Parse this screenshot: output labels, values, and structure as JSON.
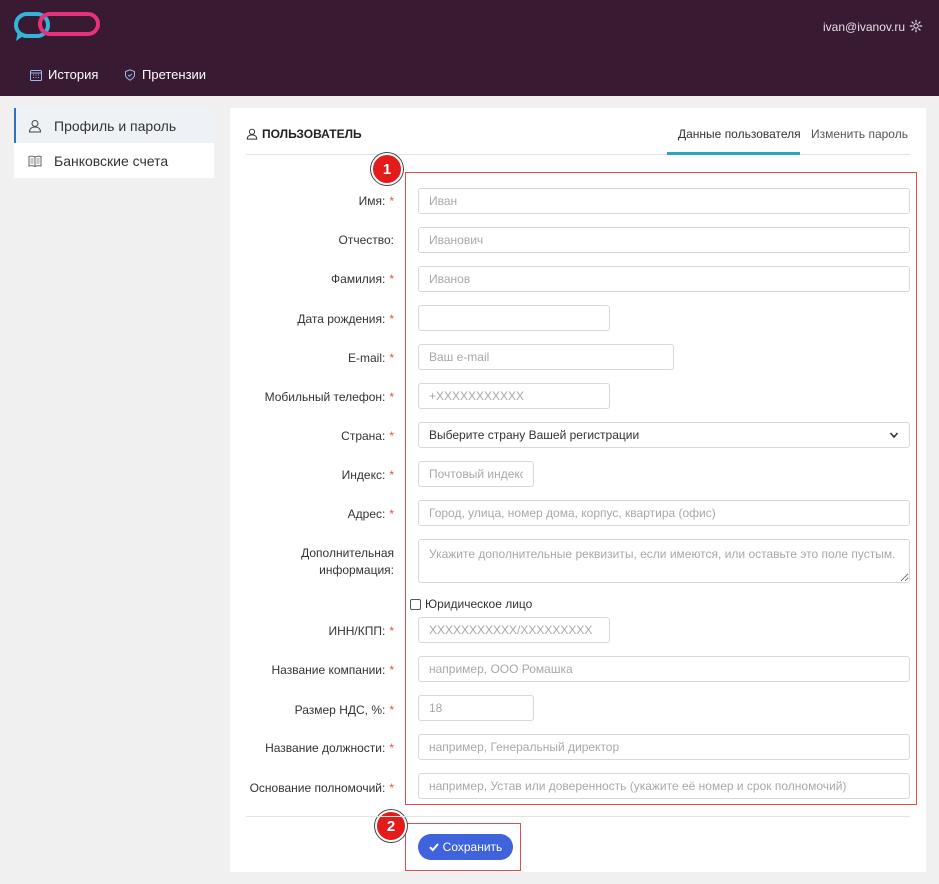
{
  "header": {
    "user_email": "ivan@ivanov.ru",
    "nav": [
      {
        "label": "История",
        "icon": "calendar-icon"
      },
      {
        "label": "Претензии",
        "icon": "shield-icon"
      }
    ]
  },
  "sidebar": {
    "items": [
      {
        "label": "Профиль и пароль",
        "icon": "user-icon",
        "active": true
      },
      {
        "label": "Банковские счета",
        "icon": "book-icon",
        "active": false
      }
    ]
  },
  "card": {
    "title": "ПОЛЬЗОВАТЕЛЬ",
    "tabs": [
      {
        "label": "Данные пользователя",
        "active": true
      },
      {
        "label": "Изменить пароль",
        "active": false
      }
    ]
  },
  "annotations": {
    "badge1": "1",
    "badge2": "2"
  },
  "form": {
    "first_name": {
      "label": "Имя:",
      "required": "*",
      "placeholder": "Иван"
    },
    "patronymic": {
      "label": "Отчество:",
      "placeholder": "Иванович"
    },
    "last_name": {
      "label": "Фамилия:",
      "required": "*",
      "placeholder": "Иванов"
    },
    "birth_date": {
      "label": "Дата рождения:",
      "required": "*",
      "placeholder": ""
    },
    "email": {
      "label": "E-mail:",
      "required": "*",
      "placeholder": "Ваш e-mail"
    },
    "phone": {
      "label": "Мобильный телефон:",
      "required": "*",
      "placeholder": "+XXXXXXXXXXX"
    },
    "country": {
      "label": "Страна:",
      "required": "*",
      "selected": "Выберите страну Вашей регистрации"
    },
    "zip": {
      "label": "Индекс:",
      "required": "*",
      "placeholder": "Почтовый индекс"
    },
    "address": {
      "label": "Адрес:",
      "required": "*",
      "placeholder": "Город, улица, номер дома, корпус, квартира (офис)"
    },
    "extra_info": {
      "label_line1": "Дополнительная",
      "label_line2": "информация:",
      "placeholder": "Укажите дополнительные реквизиты, если имеются, или оставьте это поле пустым."
    },
    "legal_entity": {
      "label": "Юридическое лицо",
      "checked": false
    },
    "inn": {
      "label": "ИНН/КПП:",
      "required": "*",
      "placeholder": "XXXXXXXXXXX/XXXXXXXXX"
    },
    "company": {
      "label": "Название компании:",
      "required": "*",
      "placeholder": "например, ООО Ромашка"
    },
    "vat": {
      "label": "Размер НДС, %:",
      "required": "*",
      "placeholder": "18"
    },
    "position": {
      "label": "Название должности:",
      "required": "*",
      "placeholder": "например, Генеральный директор"
    },
    "authority": {
      "label": "Основание полномочий:",
      "required": "*",
      "placeholder": "например, Устав или доверенность (укажите её номер и срок полномочий)"
    },
    "save_label": "Сохранить"
  },
  "colors": {
    "header_bg": "#381b33",
    "accent": "#3e63dd",
    "tab_underline": "#2fa4c6",
    "annotation": "#e21b1b"
  }
}
